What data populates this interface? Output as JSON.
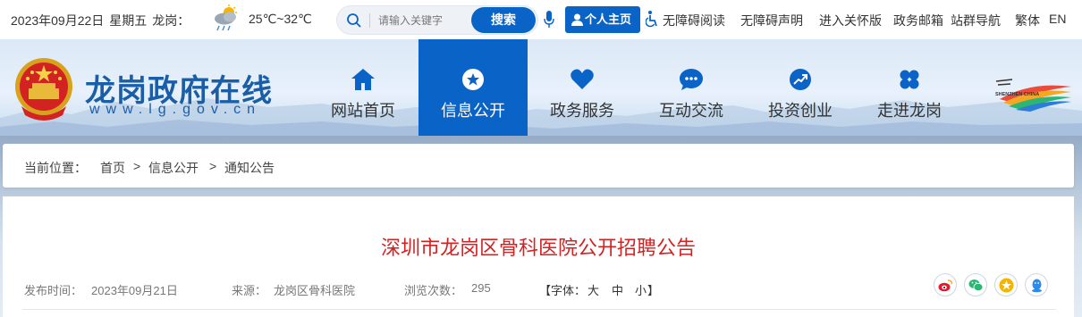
{
  "topbar": {
    "date": "2023年09月22日",
    "weekday": "星期五",
    "city": "龙岗：",
    "weather_icon": "cloud-rain-icon",
    "temperature": "25℃~32℃",
    "search_placeholder": "请输入关键字",
    "search_button": "搜索",
    "personal_button": "个人主页",
    "links": [
      "无障碍阅读",
      "无障碍声明",
      "进入关怀版",
      "政务邮箱",
      "站群导航",
      "繁体",
      "EN"
    ]
  },
  "header": {
    "site_title": "龙岗政府在线",
    "site_url": "www.lg.gov.cn",
    "nav": [
      {
        "label": "网站首页",
        "icon": "home-icon"
      },
      {
        "label": "信息公开",
        "icon": "star-icon",
        "active": true
      },
      {
        "label": "政务服务",
        "icon": "heart-icon"
      },
      {
        "label": "互动交流",
        "icon": "chat-icon"
      },
      {
        "label": "投资创业",
        "icon": "trend-icon"
      },
      {
        "label": "走进龙岗",
        "icon": "grid-icon"
      }
    ],
    "partner_logo_text": "SHENZHEN CHINA"
  },
  "breadcrumb": {
    "prefix": "当前位置：",
    "items": [
      "首页",
      "信息公开",
      "通知公告"
    ],
    "separator": ">"
  },
  "article": {
    "title": "深圳市龙岗区骨科医院公开招聘公告",
    "publish_label": "发布时间：",
    "publish_date": "2023年09月21日",
    "source_label": "来源：",
    "source": "龙岗区骨科医院",
    "views_label": "浏览次数：",
    "views": "295",
    "font_label": "【字体：",
    "font_sizes": [
      "大",
      "中",
      "小"
    ],
    "font_close": "】",
    "share_icons": [
      "weibo-icon",
      "wechat-icon",
      "favorite-icon",
      "qq-icon"
    ]
  },
  "colors": {
    "primary": "#0a63c6",
    "title_red": "#d32222"
  }
}
